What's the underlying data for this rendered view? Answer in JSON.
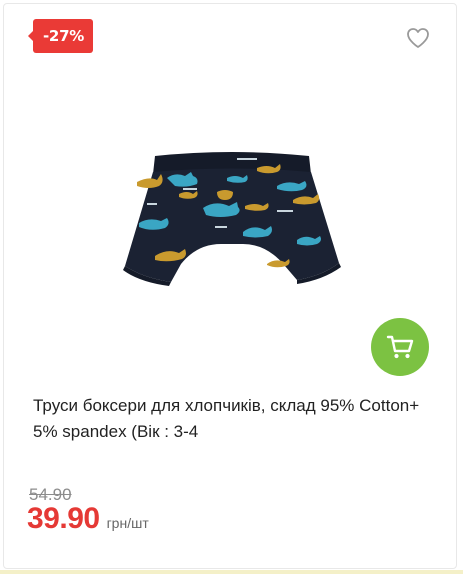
{
  "product": {
    "discount_badge": "-27%",
    "title": "Труси боксери для хлопчиків, склад 95% Cotton+ 5% spandex (Вік : 3-4",
    "old_price": "54.90",
    "new_price": "39.90",
    "unit": "грн/шт",
    "image_alt": "boxer-briefs-dinosaur-print"
  },
  "icons": {
    "wishlist": "heart-outline-icon",
    "cart": "shopping-cart-icon"
  },
  "colors": {
    "badge": "#ea3a36",
    "cart_button": "#7cc242",
    "price": "#e53935",
    "fabric": "#1b2233",
    "dino_teal": "#3aa6c4",
    "dino_mustard": "#c99a2e"
  }
}
